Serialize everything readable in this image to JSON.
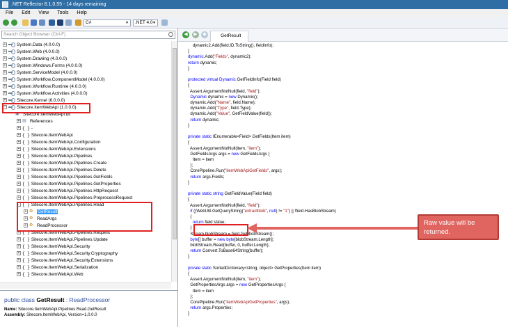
{
  "window": {
    "title": ".NET Reflector 8.1.0.55 - 14 days remaining"
  },
  "menu": [
    "File",
    "Edit",
    "View",
    "Tools",
    "Help"
  ],
  "toolbar": {
    "language": "C#",
    "framework": ".NET 4.0"
  },
  "search": {
    "placeholder": "Search Object Browser (Ctrl-F)"
  },
  "tree": [
    {
      "label": "System.Data (4.0.0.0)",
      "kind": "asm",
      "indent": 0
    },
    {
      "label": "System.Web (4.0.0.0)",
      "kind": "asm",
      "indent": 0
    },
    {
      "label": "System.Drawing (4.0.0.0)",
      "kind": "asm",
      "indent": 0
    },
    {
      "label": "System.Windows.Forms (4.0.0.0)",
      "kind": "asm",
      "indent": 0
    },
    {
      "label": "System.ServiceModel (4.0.0.0)",
      "kind": "asm",
      "indent": 0
    },
    {
      "label": "System.Workflow.ComponentModel (4.0.0.0)",
      "kind": "asm",
      "indent": 0
    },
    {
      "label": "System.Workflow.Runtime (4.0.0.0)",
      "kind": "asm",
      "indent": 0
    },
    {
      "label": "System.Workflow.Activities (4.0.0.0)",
      "kind": "asm",
      "indent": 0
    },
    {
      "label": "Sitecore.Kernel (6.0.0.0)",
      "kind": "asm",
      "indent": 0
    },
    {
      "label": "Sitecore.ItemWebApi (1.0.0.0)",
      "kind": "asm",
      "indent": 0,
      "expanded": true
    },
    {
      "label": "Sitecore.ItemWebApi.dll",
      "kind": "dll",
      "indent": 1
    },
    {
      "label": "References",
      "kind": "ref",
      "indent": 2
    },
    {
      "label": "-",
      "kind": "ns",
      "indent": 2
    },
    {
      "label": "Sitecore.ItemWebApi",
      "kind": "ns",
      "indent": 2
    },
    {
      "label": "Sitecore.ItemWebApi.Configuration",
      "kind": "ns",
      "indent": 2
    },
    {
      "label": "Sitecore.ItemWebApi.Extensions",
      "kind": "ns",
      "indent": 2
    },
    {
      "label": "Sitecore.ItemWebApi.Pipelines",
      "kind": "ns",
      "indent": 2
    },
    {
      "label": "Sitecore.ItemWebApi.Pipelines.Create",
      "kind": "ns",
      "indent": 2
    },
    {
      "label": "Sitecore.ItemWebApi.Pipelines.Delete",
      "kind": "ns",
      "indent": 2
    },
    {
      "label": "Sitecore.ItemWebApi.Pipelines.GetFields",
      "kind": "ns",
      "indent": 2
    },
    {
      "label": "Sitecore.ItemWebApi.Pipelines.GetProperties",
      "kind": "ns",
      "indent": 2
    },
    {
      "label": "Sitecore.ItemWebApi.Pipelines.HttpRequest",
      "kind": "ns",
      "indent": 2
    },
    {
      "label": "Sitecore.ItemWebApi.Pipelines.PreprocessRequest",
      "kind": "ns",
      "indent": 2
    },
    {
      "label": "Sitecore.ItemWebApi.Pipelines.Read",
      "kind": "ns",
      "indent": 2,
      "expanded": true
    },
    {
      "label": "GetResult",
      "kind": "cls",
      "indent": 3,
      "selected": true
    },
    {
      "label": "ReadArgs",
      "kind": "cls",
      "indent": 3
    },
    {
      "label": "ReadProcessor",
      "kind": "cls",
      "indent": 3
    },
    {
      "label": "Sitecore.ItemWebApi.Pipelines.Request",
      "kind": "ns",
      "indent": 2
    },
    {
      "label": "Sitecore.ItemWebApi.Pipelines.Update",
      "kind": "ns",
      "indent": 2
    },
    {
      "label": "Sitecore.ItemWebApi.Security",
      "kind": "ns",
      "indent": 2
    },
    {
      "label": "Sitecore.ItemWebApi.Security.Cryptography",
      "kind": "ns",
      "indent": 2
    },
    {
      "label": "Sitecore.ItemWebApi.Security.Extensions",
      "kind": "ns",
      "indent": 2
    },
    {
      "label": "Sitecore.ItemWebApi.Serialization",
      "kind": "ns",
      "indent": 2
    },
    {
      "label": "Sitecore.ItemWebApi.Web",
      "kind": "ns",
      "indent": 2
    }
  ],
  "info": {
    "sig_prefix": "public class ",
    "sig_name": "GetResult",
    "sig_suffix": " : ReadProcessor",
    "name_label": "Name:",
    "name_value": "Sitecore.ItemWebApi.Pipelines.Read.GetResult",
    "assembly_label": "Assembly:",
    "assembly_value": "Sitecore.ItemWebApi, Version=1.0.0.0"
  },
  "tab": {
    "label": "GetResult"
  },
  "code": [
    "[[\"    dynamic2.Add(field.ID.ToString(), fieldInfo);\",\"\"]]",
    "[[\"}\",\"\"]]",
    "[[\"dynamic\",\"kw\"],[\".Add(\",\"\"],[\"\\\"Fields\\\"\",\"st\"],[\", dynamic2);\",\"\"]]",
    "[[\"return\",\"kw\"],[\" dynamic;\",\"\"]]",
    "[[\"}\",\"\"]]",
    "[[\"\",\"\"]]",
    "[[\"protected virtual Dynamic \",\"kw\"],[\"GetFieldInfo(Field field)\",\"\"]]",
    "[[\"{\",\"\"]]",
    "[[\"  Assert.ArgumentNotNull(field, \",\"\"],[\"\\\"field\\\"\",\"st\"],[\");\",\"\"]]",
    "[[\"  Dynamic \",\"kw\"],[\"dynamic = \",\"\"],[\"new \",\"kw\"],[\"Dynamic();\",\"\"]]",
    "[[\"  dynamic.Add(\",\"\"],[\"\\\"Name\\\"\",\"st\"],[\", field.Name);\",\"\"]]",
    "[[\"  dynamic.Add(\",\"\"],[\"\\\"Type\\\"\",\"st\"],[\", field.Type);\",\"\"]]",
    "[[\"  dynamic.Add(\",\"\"],[\"\\\"Value\\\"\",\"st\"],[\", GetFieldValue(field));\",\"\"]]",
    "[[\"  return \",\"kw\"],[\"dynamic;\",\"\"]]",
    "[[\"}\",\"\"]]",
    "[[\"\",\"\"]]",
    "[[\"private static \",\"kw\"],[\"IEnumerable<Field> \",\"\"],[\"GetFields(Item item)\",\"\"]]",
    "[[\"{\",\"\"]]",
    "[[\"  Assert.ArgumentNotNull(item, \",\"\"],[\"\\\"item\\\"\",\"st\"],[\");\",\"\"]]",
    "[[\"  GetFieldsArgs args = \",\"\"],[\"new \",\"kw\"],[\"GetFieldsArgs {\",\"\"]]",
    "[[\"    Item = item\",\"\"]]",
    "[[\"  };\",\"\"]]",
    "[[\"  CorePipeline.Run(\",\"\"],[\"\\\"itemWebApiGetFields\\\"\",\"st\"],[\", args);\",\"\"]]",
    "[[\"  return \",\"kw\"],[\"args.Fields;\",\"\"]]",
    "[[\"}\",\"\"]]",
    "[[\"\",\"\"]]",
    "[[\"private static string \",\"kw\"],[\"GetFieldValue(Field field)\",\"\"]]",
    "[[\"{\",\"\"]]",
    "[[\"  Assert.ArgumentNotNull(field, \",\"\"],[\"\\\"field\\\"\",\"st\"],[\");\",\"\"]]",
    "[[\"  if \",\"kw\"],[\"((WebUtil.GetQueryString(\",\"\"],[\"\\\"extractblob\\\"\",\"st\"],[\", \",\"\"],[\"null\",\"kw\"],[\") != \",\"\"],[\"\\\"1\\\"\",\"st\"],[\") || !field.HasBlobStream)\",\"\"]]",
    "[[\"  {\",\"\"]]",
    "[[\"    return \",\"kw\"],[\"field.Value;\",\"\"]]",
    "[[\"  }\",\"\"]]",
    "[[\"  Stream \",\"\"],[\"blobStream = field.GetBlobStream();\",\"\"]]",
    "[[\"  byte\",\"kw\"],[\"[] buffer = \",\"\"],[\"new byte\",\"kw\"],[\"[blobStream.Length];\",\"\"]]",
    "[[\"  blobStream.Read(buffer, 0, buffer.Length);\",\"\"]]",
    "[[\"  return \",\"kw\"],[\"Convert.ToBase64String(buffer);\",\"\"]]",
    "[[\"}\",\"\"]]",
    "[[\"\",\"\"]]",
    "[[\"private static \",\"kw\"],[\"SortedDictionary<string, object> \",\"\"],[\"GetProperties(Item item)\",\"\"]]",
    "[[\"{\",\"\"]]",
    "[[\"  Assert.ArgumentNotNull(item, \",\"\"],[\"\\\"item\\\"\",\"st\"],[\");\",\"\"]]",
    "[[\"  GetPropertiesArgs args = \",\"\"],[\"new \",\"kw\"],[\"GetPropertiesArgs {\",\"\"]]",
    "[[\"    Item = item\",\"\"]]",
    "[[\"  };\",\"\"]]",
    "[[\"  CorePipeline.Run(\",\"\"],[\"\\\"itemWebApiGetProperties\\\"\",\"st\"],[\", args);\",\"\"]]",
    "[[\"  return \",\"kw\"],[\"args.Properties;\",\"\"]]",
    "[[\"}\",\"\"]]"
  ],
  "callout": {
    "text": "Raw value will be returned."
  },
  "colors": {
    "title_bar": "#2f6ea5",
    "selection": "#3399ff",
    "highlight_box": "#e02020",
    "callout": "#e06560"
  }
}
